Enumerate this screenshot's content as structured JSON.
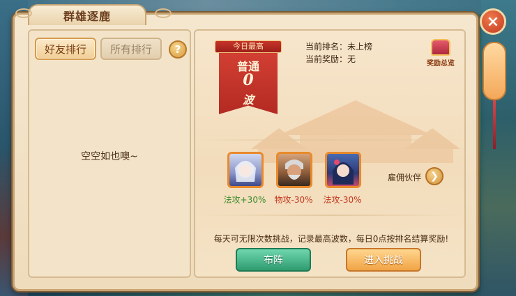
{
  "window": {
    "title": "群雄逐鹿"
  },
  "left_panel": {
    "tabs": [
      {
        "label": "好友排行",
        "active": true
      },
      {
        "label": "所有排行",
        "active": false
      }
    ],
    "help_label": "?",
    "empty_text": "空空如也噢~"
  },
  "right_panel": {
    "banner": {
      "header": "今日最高",
      "mode": "普通",
      "waves": "0",
      "unit": "波"
    },
    "rank_label": "当前排名：未上榜",
    "reward_label": "当前奖励：无",
    "reward_preview_label": "奖励总览",
    "heroes": [
      {
        "name": "hero-white-hair-girl",
        "bonus": "法攻+30%",
        "kind": "good"
      },
      {
        "name": "hero-old-warrior",
        "bonus": "物攻-30%",
        "kind": "bad"
      },
      {
        "name": "hero-dark-hair-girl",
        "bonus": "法攻-30%",
        "kind": "bad"
      }
    ],
    "hire_label": "雇佣伙伴",
    "notice": "每天可无限次数挑战，记录最高波数，每日0点按排名结算奖励!",
    "formation_button": "布阵",
    "challenge_button": "进入挑战"
  },
  "close_label": "×",
  "colors": {
    "accent_red": "#c7342a",
    "bonus_good": "#3b8a2a",
    "bonus_bad": "#c2361f",
    "btn_green": "#2f9c70",
    "btn_orange": "#f1a445"
  }
}
